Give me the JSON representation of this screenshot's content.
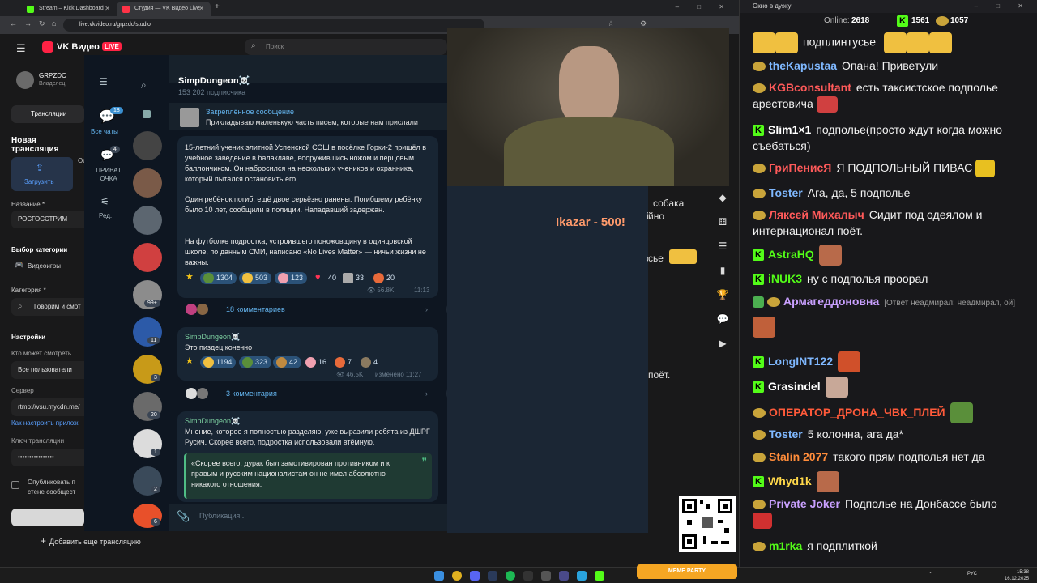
{
  "browser": {
    "tabs": [
      {
        "label": "Stream – Kick Dashboard",
        "color": "#53fc18"
      },
      {
        "label": "Студия — VK Видео Live",
        "color": "#ff3347"
      }
    ],
    "new_tab": "+",
    "url": "live.vkvideo.ru/grpzdc/studio",
    "window_controls": [
      "–",
      "□",
      "✕"
    ]
  },
  "vk": {
    "logo": "VK Видео",
    "live_badge": "LIVE",
    "search_placeholder": "Поиск",
    "user_name": "GRPZDC",
    "user_role": "Владелец",
    "nav_tab": "Трансляции",
    "section_title": "Новая трансляция",
    "upload_label": "Загрузить",
    "upload_side_text": "Ос",
    "name_label": "Название *",
    "name_value": "РОСГОССТРИМ",
    "category_choice_label": "Выбор категории",
    "category_option": "Видеоигры",
    "category_label": "Категория *",
    "category_value": "Говорим и смот",
    "settings_label": "Настройки",
    "who_watch_label": "Кто может смотреть",
    "who_watch_value": "Все пользователи",
    "server_label": "Сервер",
    "server_value": "rtmp://vsu.mycdn.me/",
    "howto_link": "Как настроить прилож",
    "key_label": "Ключ трансляции",
    "key_value": "••••••••••••••••",
    "publish_label": "Опубликовать п стене сообщест",
    "add_stream_button": "Добавить еще трансляцию",
    "overlay_text": "Ikazar - 500!",
    "bg_fragments": [
      "собака",
      "йно",
      "сье",
      "поёт."
    ]
  },
  "telegram": {
    "rail": {
      "all_chats_label": "Все чаты",
      "all_chats_badge": "18",
      "private_label": "ПРИВАТ ОЧКА",
      "private_badge": "4",
      "edit_label": "Ред."
    },
    "chat_badges": [
      "99+",
      "11",
      "3",
      "20",
      "1",
      "2",
      "6"
    ],
    "channel_name": "SimpDungeon☠️",
    "subscribers": "153 202 подписчика",
    "pinned_title": "Закреплённое сообщение",
    "pinned_text": "Прикладываю маленькую часть писем, которые нам прислали",
    "messages": [
      {
        "text1": "15-летний ученик элитной Успенской СОШ в посёлке Горки-2 пришёл в учебное заведение в балаклаве, вооружившись ножом и перцовым баллончиком. Он набросился на нескольких учеников и охранника, который пытался остановить его.",
        "text2": "Один ребёнок погиб, ещё двое серьёзно ранены. Погибшему ребёнку было 10 лет, сообщили в полиции. Нападавший задержан.",
        "text3": "На футболке подростка, устроившего поножовщину в одинцовской школе, по данным СМИ, написано «No Lives Matter» — ничьи жизни не важны.",
        "reactions": [
          "1304",
          "503",
          "123",
          "40",
          "33",
          "20"
        ],
        "views": "56.8K",
        "time": "11:13",
        "comments": "18 комментариев"
      },
      {
        "author": "SimpDungeon☠️",
        "text": "Это пиздец конечно",
        "reactions": [
          "1194",
          "323",
          "42",
          "16",
          "7",
          "4"
        ],
        "views": "46.5K",
        "edited": "изменено 11:27",
        "comments": "3 комментария"
      },
      {
        "author": "SimpDungeon☠️",
        "text": "Мнение, которое я полностью разделяю, уже выразили ребята из ДШРГ Русич. Скорее всего, подростка использовали втёмную.",
        "quote": "«Скорее всего, дурак был замотивирован противником и к правым и русским националистам он не имел абсолютно никакого отношения."
      }
    ],
    "input_placeholder": "Публикация..."
  },
  "chat": {
    "window_title": "Окно в дуэку",
    "online_label": "Online:",
    "online_value": "2618",
    "kick_count": "1561",
    "vk_count": "1057",
    "messages": [
      {
        "platform": "none",
        "user": "",
        "color": "#ffffff",
        "text": "подплинтусье"
      },
      {
        "platform": "vk",
        "user": "theKapustaa",
        "color": "#7fb8ff",
        "text": "Опана! Приветули"
      },
      {
        "platform": "vk",
        "user": "KGBconsultant",
        "color": "#ff5a5a",
        "text": "есть таксистское подполье арестовича"
      },
      {
        "platform": "kick",
        "user": "Slim1×1",
        "color": "#ffffff",
        "text": "подполье(просто ждут когда можно съебаться)"
      },
      {
        "platform": "vk",
        "user": "ГриПенисЯ",
        "color": "#ff5a5a",
        "text": "Я ПОДПОЛЬНЫЙ ПИВАС"
      },
      {
        "platform": "vk",
        "user": "Toster",
        "color": "#7fb8ff",
        "text": "Ага, да, 5 подполье"
      },
      {
        "platform": "vk",
        "user": "Ляксей Михалыч",
        "color": "#ff5a5a",
        "text": "Сидит под одеялом и интернационал поёт."
      },
      {
        "platform": "kick",
        "user": "AstraHQ",
        "color": "#53fc18",
        "text": ""
      },
      {
        "platform": "kick",
        "user": "iNUK3",
        "color": "#53fc18",
        "text": "ну с подполья проорал"
      },
      {
        "platform": "vk",
        "user": "Армагеддоновна",
        "color": "#c9a0ff",
        "text": "[Ответ неадмирал: неадмирал, ой]"
      },
      {
        "platform": "kick",
        "user": "LongINT122",
        "color": "#7fb8ff",
        "text": ""
      },
      {
        "platform": "kick",
        "user": "Grasindel",
        "color": "#ffffff",
        "text": ""
      },
      {
        "platform": "vk",
        "user": "ОПЕРАТОР_ДРОНА_ЧВК_ПЛЕЙ",
        "color": "#ff5a3a",
        "text": ""
      },
      {
        "platform": "vk",
        "user": "Toster",
        "color": "#7fb8ff",
        "text": "5 колонна, ага да*"
      },
      {
        "platform": "vk",
        "user": "Stalin 2077",
        "color": "#ff8c3a",
        "text": "такого прям подполья нет да"
      },
      {
        "platform": "kick",
        "user": "Whyd1k",
        "color": "#ffd84a",
        "text": ""
      },
      {
        "platform": "vk",
        "user": "Private Joker",
        "color": "#c9a0ff",
        "text": "Подполье на Донбассе было"
      },
      {
        "platform": "vk",
        "user": "m1rka",
        "color": "#53fc18",
        "text": "я подплиткой"
      }
    ]
  },
  "taskbar": {
    "lang": "РУС",
    "time": "15:38",
    "date": "16.12.2025",
    "promo": "MEME PARTY"
  }
}
